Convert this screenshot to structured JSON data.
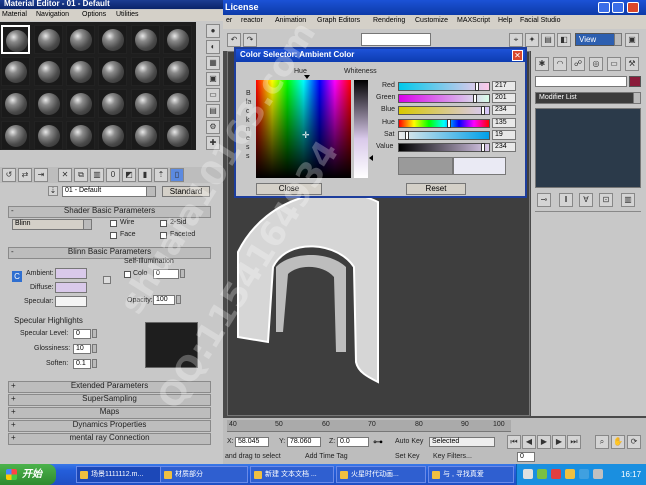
{
  "material_editor": {
    "title": "Material Editor - 01 - Default",
    "menu": [
      "Material",
      "Navigation",
      "Options",
      "Utilities"
    ],
    "material_name": "01 - Default",
    "material_type": "Standard",
    "rollouts": {
      "shader_basic": "Shader Basic Parameters",
      "blinn_basic": "Blinn Basic Parameters",
      "extended": "Extended Parameters",
      "supersampling": "SuperSampling",
      "maps": "Maps",
      "dynamics": "Dynamics Properties",
      "mental_ray": "mental ray Connection"
    },
    "shader": {
      "type": "Blinn",
      "wire": "Wire",
      "two_sided": "2-Sid",
      "face_map": "Face",
      "faceted": "Faceted"
    },
    "blinn": {
      "self_illumination": "Self-Illumination",
      "color_label": "Colo",
      "color_value": "0",
      "ambient": "Ambient:",
      "diffuse": "Diffuse:",
      "specular": "Specular:",
      "opacity_label": "Opacity:",
      "opacity_value": "100",
      "lock_c": "C"
    },
    "specular_highlights": {
      "title": "Specular Highlights",
      "level_label": "Specular Level:",
      "level_value": "0",
      "glossiness_label": "Glossiness:",
      "glossiness_value": "10",
      "soften_label": "Soften:",
      "soften_value": "0.1"
    }
  },
  "main_app": {
    "title": "License",
    "menu": [
      "er",
      "reactor",
      "Animation",
      "Graph Editors",
      "Rendering",
      "Customize",
      "MAXScript",
      "Help",
      "Facial Studio"
    ],
    "view_dropdown": "View",
    "modifier_list": "Modifier List"
  },
  "color_selector": {
    "title": "Color Selector: Ambient Color",
    "hue_label": "Hue",
    "whiteness_label": "Whiteness",
    "blackness_label": "Blackness",
    "close_button": "Close",
    "reset_button": "Reset",
    "channels": [
      {
        "label": "Red",
        "value": "217"
      },
      {
        "label": "Green",
        "value": "201"
      },
      {
        "label": "Blue",
        "value": "234"
      },
      {
        "label": "Hue",
        "value": "135"
      },
      {
        "label": "Sat",
        "value": "19"
      },
      {
        "label": "Value",
        "value": "234"
      }
    ]
  },
  "timeline": {
    "ticks": [
      "40",
      "50",
      "60",
      "70",
      "80",
      "90",
      "100"
    ],
    "x_label": "X:",
    "x_value": "58.045",
    "y_label": "Y:",
    "y_value": "78.060",
    "z_label": "Z:",
    "z_value": "0.0",
    "auto_key": "Auto Key",
    "selected": "Selected",
    "set_key": "Set Key",
    "key_filters": "Key Filters...",
    "prompt": "and drag to select",
    "add_time_tag": "Add Time Tag",
    "frame_value": "0"
  },
  "taskbar": {
    "start": "开始",
    "tasks": [
      "场景1111112.m...",
      "材质部分",
      "新建 文本文档 ...",
      "火星时代动画...",
      "与 , 寻找真爱"
    ],
    "clock": "16:17"
  },
  "watermark": {
    "line1": "shuaia10163.com",
    "line2": "QQ:1154164934"
  },
  "colors": {
    "accent_titlebar": "#0a246a",
    "dialog_border": "#1d3d9c",
    "taskbar": "#245edb",
    "start_button": "#3c9c3c",
    "ambient_swatch": "#d9c9ea"
  }
}
